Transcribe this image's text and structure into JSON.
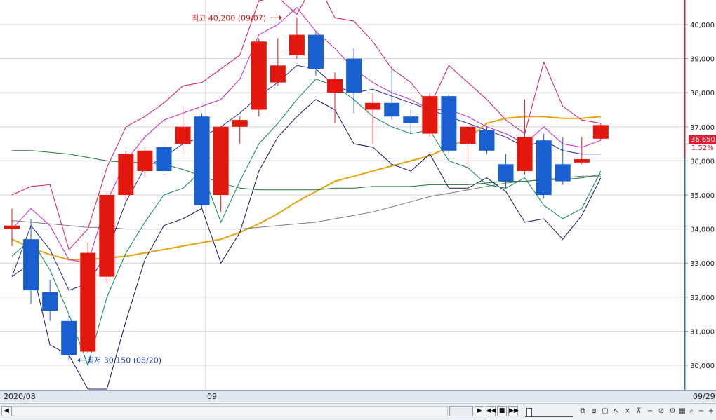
{
  "chart_data": {
    "type": "candlestick",
    "ylim": [
      29500,
      41500
    ],
    "y_ticks": [
      30000,
      31000,
      32000,
      33000,
      34000,
      35000,
      36000,
      37000,
      38000,
      39000,
      40000
    ],
    "y_tick_labels": [
      "30,000",
      "31,000",
      "32,000",
      "33,000",
      "34,000",
      "35,000",
      "36,000",
      "37,000",
      "38,000",
      "39,000",
      "40,000"
    ],
    "x_labels": [
      "2020/08",
      "09",
      "09/29"
    ],
    "grid": true,
    "candles": [
      {
        "o": 34000,
        "h": 34600,
        "l": 33500,
        "c": 34100
      },
      {
        "o": 33700,
        "h": 34300,
        "l": 31800,
        "c": 32200
      },
      {
        "o": 32150,
        "h": 32500,
        "l": 31300,
        "c": 31600
      },
      {
        "o": 31300,
        "h": 31500,
        "l": 30150,
        "c": 30300
      },
      {
        "o": 30400,
        "h": 33600,
        "l": 30350,
        "c": 33300
      },
      {
        "o": 32600,
        "h": 35100,
        "l": 32400,
        "c": 35000
      },
      {
        "o": 35000,
        "h": 36300,
        "l": 34800,
        "c": 36200
      },
      {
        "o": 35700,
        "h": 36400,
        "l": 35500,
        "c": 36300
      },
      {
        "o": 36400,
        "h": 36600,
        "l": 35600,
        "c": 35700
      },
      {
        "o": 36500,
        "h": 37600,
        "l": 36200,
        "c": 37000
      },
      {
        "o": 37300,
        "h": 37400,
        "l": 34600,
        "c": 34700
      },
      {
        "o": 35000,
        "h": 37000,
        "l": 34500,
        "c": 37000
      },
      {
        "o": 37000,
        "h": 37300,
        "l": 36500,
        "c": 37200
      },
      {
        "o": 37500,
        "h": 39600,
        "l": 37300,
        "c": 39500
      },
      {
        "o": 38300,
        "h": 39600,
        "l": 38200,
        "c": 38800
      },
      {
        "o": 39100,
        "h": 40200,
        "l": 39000,
        "c": 39700
      },
      {
        "o": 39700,
        "h": 39800,
        "l": 38500,
        "c": 38700
      },
      {
        "o": 38000,
        "h": 38600,
        "l": 37100,
        "c": 38400
      },
      {
        "o": 39000,
        "h": 39300,
        "l": 37400,
        "c": 38000
      },
      {
        "o": 37500,
        "h": 38000,
        "l": 36500,
        "c": 37700
      },
      {
        "o": 37700,
        "h": 38800,
        "l": 37200,
        "c": 37300
      },
      {
        "o": 37300,
        "h": 37500,
        "l": 36800,
        "c": 37100
      },
      {
        "o": 36800,
        "h": 38000,
        "l": 36700,
        "c": 37900
      },
      {
        "o": 37900,
        "h": 37950,
        "l": 36200,
        "c": 36300
      },
      {
        "o": 36500,
        "h": 37000,
        "l": 35800,
        "c": 37000
      },
      {
        "o": 36900,
        "h": 37000,
        "l": 36200,
        "c": 36300
      },
      {
        "o": 35900,
        "h": 36200,
        "l": 35200,
        "c": 35400
      },
      {
        "o": 35700,
        "h": 37800,
        "l": 35600,
        "c": 36700
      },
      {
        "o": 36600,
        "h": 36800,
        "l": 34900,
        "c": 35000
      },
      {
        "o": 35900,
        "h": 36700,
        "l": 35300,
        "c": 35400
      },
      {
        "o": 35950,
        "h": 36700,
        "l": 35900,
        "c": 36050
      },
      {
        "o": 36650,
        "h": 37100,
        "l": 36600,
        "c": 37050
      }
    ],
    "ma_series": [
      {
        "color": "#e8a20c",
        "values": [
          33700,
          33450,
          33250,
          33100,
          33100,
          33150,
          33200,
          33300,
          33400,
          33500,
          33600,
          33700,
          33900,
          34150,
          34450,
          34800,
          35100,
          35400,
          35550,
          35700,
          35850,
          36000,
          36150,
          36400,
          36650,
          37100,
          37250,
          37300,
          37300,
          37250,
          37250,
          37300
        ]
      },
      {
        "color": "#7a7a7a",
        "values": [
          34250,
          34200,
          34150,
          34100,
          34050,
          34050,
          34000,
          34000,
          34000,
          34000,
          34000,
          34000,
          34000,
          34050,
          34100,
          34150,
          34200,
          34300,
          34400,
          34500,
          34650,
          34800,
          34950,
          35050,
          35150,
          35250,
          35350,
          35400,
          35450,
          35500,
          35550,
          35550
        ]
      },
      {
        "color": "#1a7a3a",
        "values": [
          36300,
          36300,
          36250,
          36200,
          36100,
          36000,
          35950,
          35950,
          35900,
          35750,
          35550,
          35350,
          35200,
          35150,
          35150,
          35150,
          35150,
          35200,
          35200,
          35250,
          35250,
          35250,
          35300,
          35300,
          35300,
          35350,
          35400,
          35400,
          35450,
          35450,
          35500,
          35600
        ]
      },
      {
        "color": "#d8185a",
        "values": [
          35000,
          35250,
          35300,
          33400,
          34000,
          35800,
          37000,
          37300,
          37700,
          38200,
          38300,
          38700,
          39100,
          40700,
          40800,
          40300,
          41300,
          40200,
          40100,
          39500,
          38700,
          38300,
          37600,
          38800,
          38300,
          37800,
          37200,
          36800,
          38900,
          37600,
          37200,
          37100
        ]
      },
      {
        "color": "#cc22cc",
        "values": [
          34000,
          34600,
          34100,
          33100,
          33000,
          34800,
          36000,
          36700,
          37200,
          37400,
          37600,
          37800,
          38400,
          39700,
          40000,
          40500,
          39800,
          39300,
          38700,
          38300,
          38000,
          37800,
          37500,
          37500,
          37300,
          37000,
          36800,
          36500,
          37000,
          36500,
          36400,
          36600
        ]
      },
      {
        "color": "#1f2a9a",
        "values": [
          32600,
          34100,
          33400,
          32200,
          32400,
          33300,
          34800,
          35800,
          36100,
          36500,
          36700,
          37000,
          37400,
          37900,
          38300,
          38800,
          38700,
          38200,
          38000,
          38100,
          37900,
          37700,
          37500,
          37300,
          37100,
          36900,
          36700,
          36400,
          36600,
          36300,
          36200,
          36200
        ]
      },
      {
        "color": "#0a8a4a",
        "values": [
          33200,
          33700,
          32800,
          31500,
          30000,
          32000,
          33300,
          34200,
          35000,
          35200,
          35700,
          34200,
          35400,
          36500,
          37100,
          37800,
          38400,
          38200,
          37800,
          37300,
          37000,
          36800,
          36900,
          36000,
          35800,
          35300,
          35200,
          35500,
          34700,
          34300,
          34600,
          35700
        ]
      },
      {
        "color": "#141860",
        "values": [
          32600,
          33000,
          30600,
          30300,
          29300,
          29300,
          31300,
          33100,
          34100,
          34300,
          34600,
          33000,
          33900,
          35700,
          36700,
          37300,
          37800,
          37500,
          36500,
          36400,
          35900,
          35700,
          36200,
          35200,
          35200,
          35500,
          35100,
          34200,
          34300,
          33700,
          34400,
          35500
        ]
      }
    ],
    "annotations": {
      "high": "최고 40,200 (09/07)",
      "low": "최저 30,150 (08/20)"
    },
    "current_price": "36,650",
    "change_pct": "1.52%"
  },
  "colors": {
    "up": "#e2180e",
    "down": "#1a5fd0",
    "accent": "#e8192c"
  }
}
